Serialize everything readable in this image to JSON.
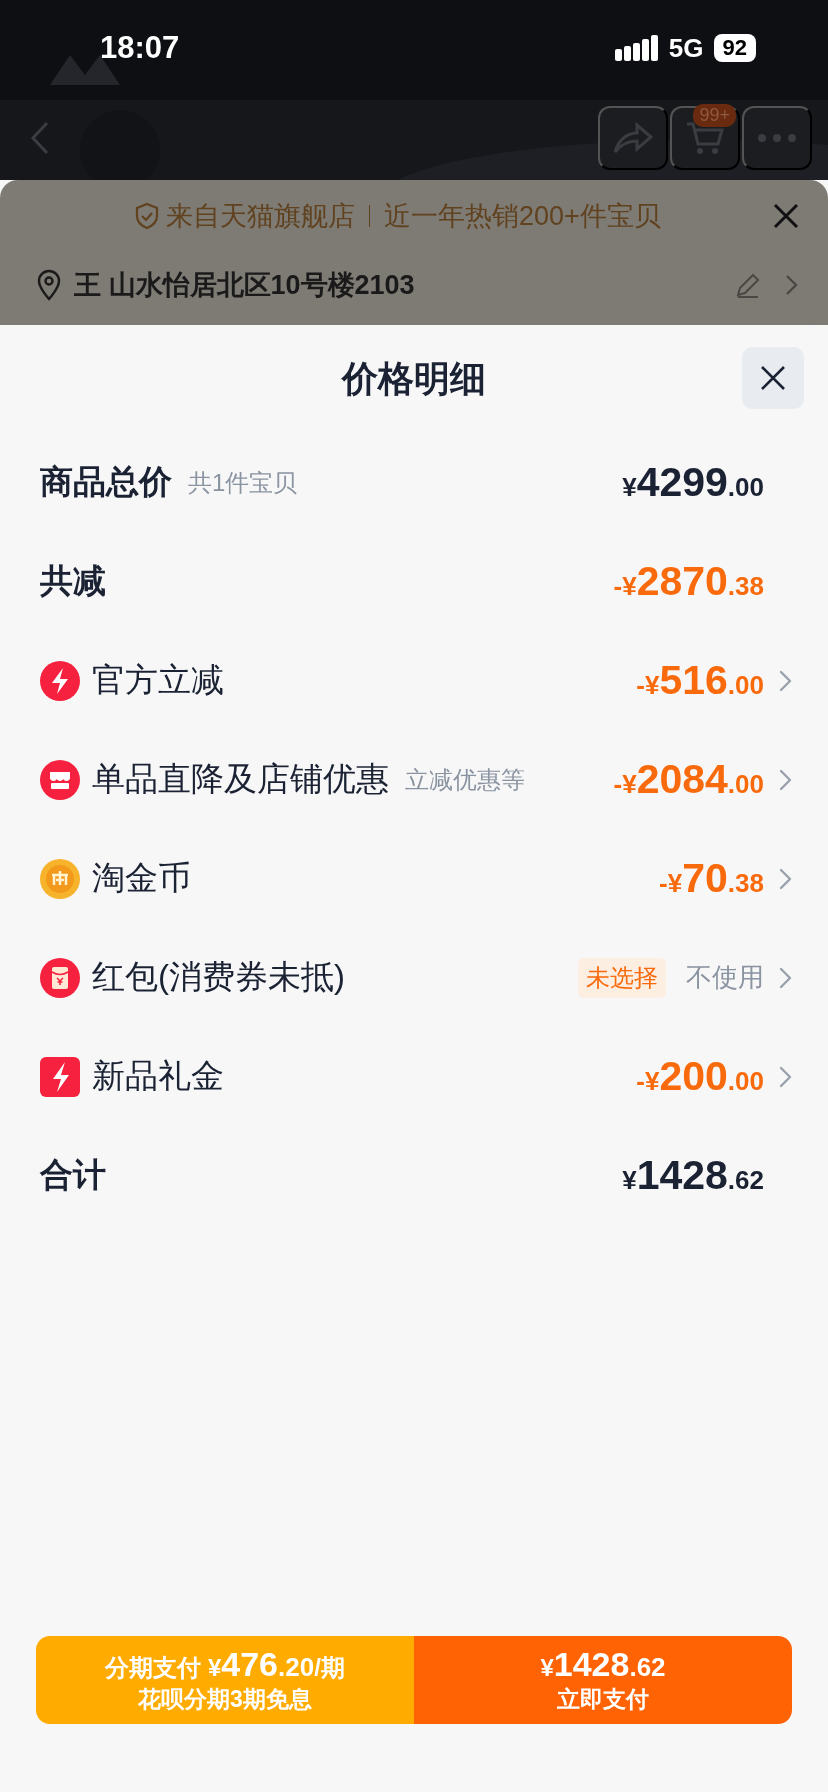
{
  "status_bar": {
    "time": "18:07",
    "network": "5G",
    "battery": "92"
  },
  "nav": {
    "cart_badge": "99+"
  },
  "store_banner": {
    "text": "来自天猫旗舰店",
    "highlight": "近一年热销200+件宝贝"
  },
  "address": {
    "text": "王 山水怡居北区10号楼2103"
  },
  "sheet": {
    "title": "价格明细"
  },
  "rows": [
    {
      "kind": "subtotal",
      "label": "商品总价",
      "note": "共1件宝贝",
      "price": {
        "sign": "¥",
        "integer": "4299",
        "decimal": ".00"
      }
    },
    {
      "kind": "saving",
      "label": "共减",
      "price": {
        "sign": "-¥",
        "integer": "2870",
        "decimal": ".38"
      }
    },
    {
      "kind": "discount",
      "label": "官方立减",
      "price": {
        "sign": "-¥",
        "integer": "516",
        "decimal": ".00"
      }
    },
    {
      "kind": "discount",
      "label": "单品直降及店铺优惠",
      "note": "立减优惠等",
      "price": {
        "sign": "-¥",
        "integer": "2084",
        "decimal": ".00"
      }
    },
    {
      "kind": "discount",
      "label": "淘金币",
      "price": {
        "sign": "-¥",
        "integer": "70",
        "decimal": ".38"
      }
    },
    {
      "kind": "option",
      "label": "红包(消费券未抵)",
      "tag": "未选择",
      "value": "不使用"
    },
    {
      "kind": "discount",
      "label": "新品礼金",
      "price": {
        "sign": "-¥",
        "integer": "200",
        "decimal": ".00"
      }
    },
    {
      "kind": "total",
      "label": "合计",
      "price": {
        "sign": "¥",
        "integer": "1428",
        "decimal": ".62"
      }
    }
  ],
  "pay_bar": {
    "installment": {
      "prefix": "分期支付",
      "sign": "¥",
      "integer": "476",
      "decimal": ".20",
      "suffix": "/期",
      "subtitle": "花呗分期3期免息"
    },
    "pay_now": {
      "sign": "¥",
      "integer": "1428",
      "decimal": ".62",
      "label": "立即支付"
    }
  }
}
